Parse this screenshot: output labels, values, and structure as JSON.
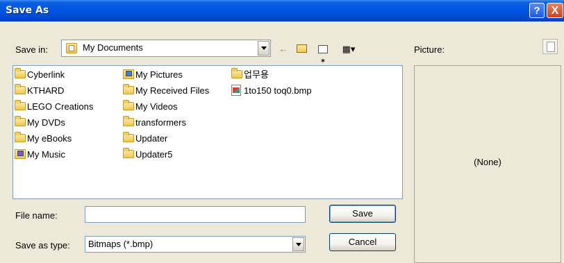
{
  "window": {
    "title": "Save As"
  },
  "titlebar": {
    "help_label": "?",
    "close_label": "X"
  },
  "toolbar": {
    "save_in_label": "Save in:",
    "save_in_value": "My Documents",
    "back_glyph": "←",
    "up_glyph": "⊡",
    "new_folder_glyph": "✶",
    "views_glyph": "▦▾"
  },
  "files": {
    "col1": [
      "Cyberlink",
      "KTHARD",
      "LEGO Creations",
      "My DVDs",
      "My eBooks",
      "My Music"
    ],
    "col2": [
      "My Pictures",
      "My Received Files",
      "My Videos",
      "transformers",
      "Updater",
      "Updater5"
    ],
    "col3": [
      "업무용",
      "1to150 toq0.bmp"
    ]
  },
  "form": {
    "file_name_label": "File name:",
    "file_name_value": "",
    "save_type_label": "Save as type:",
    "save_type_value": "Bitmaps (*.bmp)",
    "save_label": "Save",
    "cancel_label": "Cancel"
  },
  "preview": {
    "label": "Picture:",
    "none_text": "(None)"
  },
  "colors": {
    "titlebar": "#0054e3",
    "dialog_bg": "#ece9d8",
    "field_border": "#7f9db9"
  }
}
